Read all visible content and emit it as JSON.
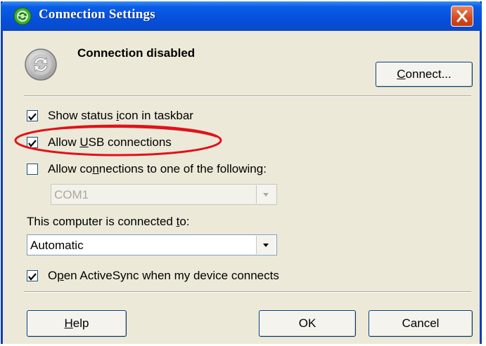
{
  "window": {
    "title": "Connection Settings",
    "colors": {
      "titlebar": "#0550dc",
      "client": "#ece9d8",
      "highlight": "#e0121b"
    }
  },
  "status": {
    "text": "Connection disabled",
    "icon": "sync-arrows-icon"
  },
  "connect_button": {
    "label_pre": "",
    "label_u": "C",
    "label_post": "onnect..."
  },
  "checkboxes": [
    {
      "pre": "Show status ",
      "u": "i",
      "post": "con in taskbar",
      "checked": true
    },
    {
      "pre": "Allow ",
      "u": "U",
      "post": "SB connections",
      "checked": true,
      "highlighted": true
    },
    {
      "pre": "Allow co",
      "u": "n",
      "post": "nections to one of the following:",
      "checked": false
    },
    {
      "pre": "O",
      "u": "p",
      "post": "en ActiveSync when my device connects",
      "checked": true
    }
  ],
  "com_select": {
    "value": "COM1",
    "disabled": true
  },
  "connected_to": {
    "label_pre": "This computer is connected ",
    "label_u": "t",
    "label_post": "o:",
    "value": "Automatic"
  },
  "buttons": {
    "help": {
      "u": "H",
      "post": "elp"
    },
    "ok": "OK",
    "cancel": "Cancel"
  }
}
